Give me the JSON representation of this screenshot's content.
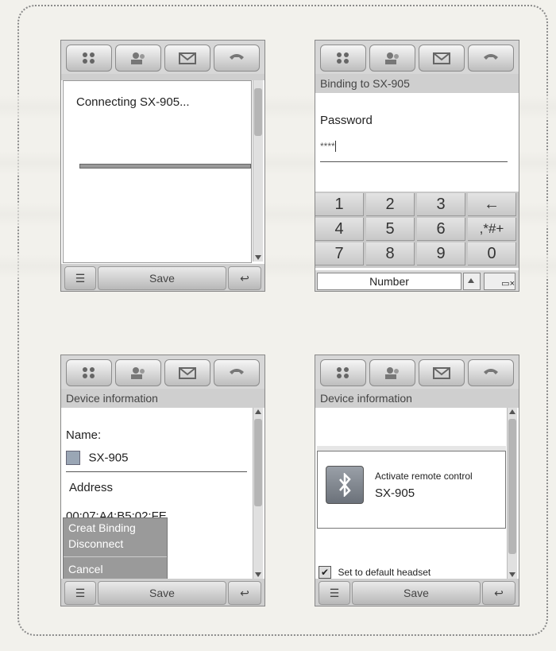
{
  "screen1": {
    "dialog_text": "Connecting SX-905...",
    "save_label": "Save"
  },
  "screen2": {
    "header": "Binding to SX-905",
    "password_label": "Password",
    "password_value": "****",
    "keys": [
      "1",
      "2",
      "3",
      "←",
      "4",
      "5",
      "6",
      ",*#+",
      "7",
      "8",
      "9",
      "0"
    ],
    "mode_label": "Number"
  },
  "screen3": {
    "header": "Device information",
    "name_label": "Name:",
    "name_value": "SX-905",
    "address_label": "Address",
    "address_value": "00:07:A4:B5:02:FE",
    "menu": [
      "Creat Binding",
      "Disconnect",
      "Cancel"
    ],
    "save_label": "Save"
  },
  "screen4": {
    "header": "Device information",
    "popup_line1": "Activate remote control",
    "popup_line2": "SX-905",
    "checkbox_label": "Set to default headset",
    "checkbox_checked": true,
    "save_label": "Save"
  },
  "icons": [
    "apps-icon",
    "contacts-icon",
    "mail-icon",
    "phone-icon",
    "menu-icon",
    "back-icon",
    "bluetooth-icon"
  ]
}
